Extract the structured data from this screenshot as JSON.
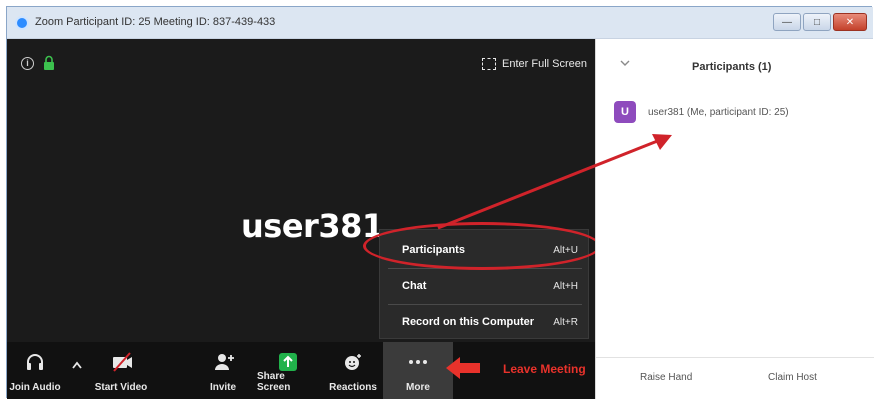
{
  "window": {
    "title": "Zoom Participant ID: 25   Meeting ID: 837-439-433",
    "controls": [
      "minimize",
      "maximize",
      "close"
    ]
  },
  "video": {
    "user_name": "user381",
    "fullscreen_label": "Enter Full Screen"
  },
  "more_menu": {
    "items": [
      {
        "label": "Participants",
        "shortcut": "Alt+U"
      },
      {
        "label": "Chat",
        "shortcut": "Alt+H"
      },
      {
        "label": "Record on this Computer",
        "shortcut": "Alt+R"
      }
    ]
  },
  "toolbar": {
    "join_audio": "Join Audio",
    "start_video": "Start Video",
    "invite": "Invite",
    "share_screen": "Share Screen",
    "reactions": "Reactions",
    "more": "More",
    "leave": "Leave Meeting"
  },
  "panel": {
    "title": "Participants (1)",
    "participant": {
      "initial": "U",
      "label": "user381 (Me, participant ID: 25)"
    },
    "raise_hand": "Raise Hand",
    "claim_host": "Claim Host"
  },
  "colors": {
    "accent_red": "#d0232a",
    "share_green": "#21b24b",
    "avatar_purple": "#8e4bbd",
    "lock_green": "#3cc14e"
  },
  "icons": [
    "info-icon",
    "lock-icon",
    "fullscreen-icon",
    "headphones-icon",
    "chevron-up-icon",
    "video-off-icon",
    "add-user-icon",
    "share-screen-icon",
    "reactions-icon",
    "more-dots-icon",
    "chevron-down-icon"
  ]
}
